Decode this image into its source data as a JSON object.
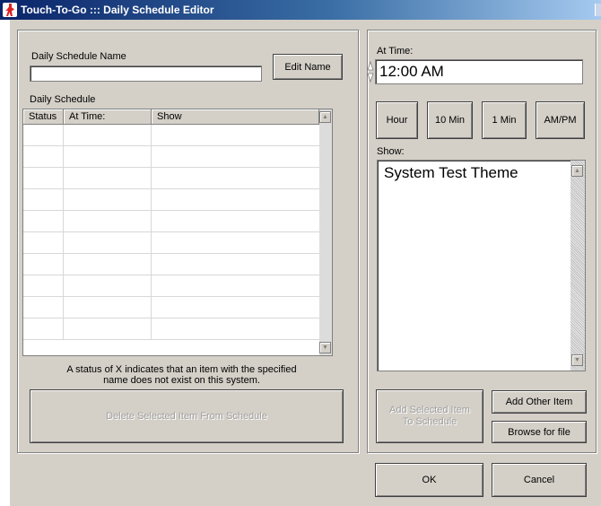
{
  "window": {
    "title": "Touch-To-Go ::: Daily Schedule Editor"
  },
  "left": {
    "name_label": "Daily Schedule Name",
    "name_value": "",
    "edit_name_label": "Edit Name",
    "schedule_label": "Daily Schedule",
    "columns": [
      "Status",
      "At Time:",
      "Show"
    ],
    "rows": [
      {
        "status": "",
        "time": "",
        "show": ""
      },
      {
        "status": "",
        "time": "",
        "show": ""
      },
      {
        "status": "",
        "time": "",
        "show": ""
      },
      {
        "status": "",
        "time": "",
        "show": ""
      },
      {
        "status": "",
        "time": "",
        "show": ""
      },
      {
        "status": "",
        "time": "",
        "show": ""
      },
      {
        "status": "",
        "time": "",
        "show": ""
      },
      {
        "status": "",
        "time": "",
        "show": ""
      },
      {
        "status": "",
        "time": "",
        "show": ""
      },
      {
        "status": "",
        "time": "",
        "show": ""
      }
    ],
    "note_line1": "A status of X indicates that an item with the specified",
    "note_line2": "name does not exist on this system.",
    "delete_label": "Delete Selected Item From Schedule"
  },
  "right": {
    "at_time_label": "At Time:",
    "time_value": "12:00 AM",
    "hour_label": "Hour",
    "ten_min_label": "10 Min",
    "one_min_label": "1 Min",
    "ampm_label": "AM/PM",
    "show_label": "Show:",
    "show_items": [
      "System Test Theme"
    ],
    "add_selected_line1": "Add Selected Item",
    "add_selected_line2": "To Schedule",
    "add_other_label": "Add Other Item",
    "browse_label": "Browse for file"
  },
  "footer": {
    "ok_label": "OK",
    "cancel_label": "Cancel"
  },
  "icons": {
    "app": "touch-to-go-figure-icon",
    "spin": "spin-arrows-icon",
    "scroll_up": "scroll-up-arrow-icon",
    "scroll_down": "scroll-down-arrow-icon"
  },
  "colors": {
    "titlebar_start": "#0a246a",
    "titlebar_end": "#a6caf0",
    "face": "#d4d0c8"
  }
}
